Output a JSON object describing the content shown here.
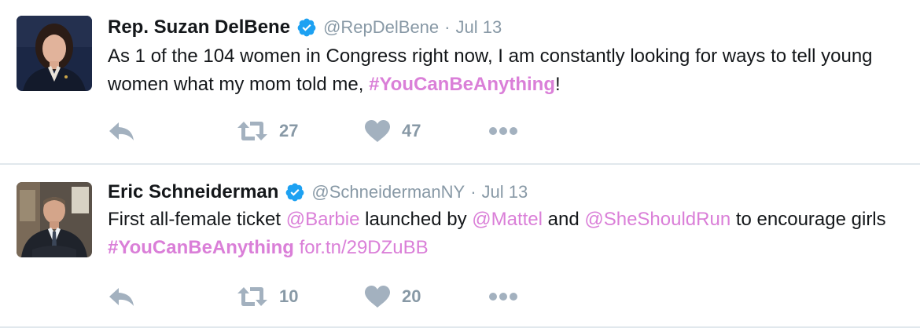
{
  "colors": {
    "name": "#14171a",
    "muted": "#8899a6",
    "highlight": "#da7fd8",
    "verified": "#1da1f2",
    "separator": "#e1e8ed"
  },
  "icons": {
    "reply": "reply-icon",
    "retweet": "retweet-icon",
    "like": "heart-icon",
    "more": "more-icon",
    "verified": "verified-badge-icon"
  },
  "tweets": [
    {
      "name": "Rep. Suzan DelBene",
      "handle": "@RepDelBene",
      "dot": "·",
      "date": "Jul 13",
      "text": {
        "part1": "As 1 of the 104 women in Congress right now, I am constantly looking for ways to tell young women what my mom told me, ",
        "hashtag": "#YouCanBeAnything",
        "part2": "!"
      },
      "retweets": "27",
      "likes": "47"
    },
    {
      "name": "Eric Schneiderman",
      "handle": "@SchneidermanNY",
      "dot": "·",
      "date": "Jul 13",
      "text": {
        "part1": "First all-female ticket ",
        "mention1": "@Barbie",
        "part2": " launched by ",
        "mention2": "@Mattel",
        "part3": " and ",
        "mention3": "@SheShouldRun",
        "part4": " to encourage girls ",
        "hashtag": "#YouCanBeAnything",
        "part5": " ",
        "link": "for.tn/29DZuBB"
      },
      "retweets": "10",
      "likes": "20"
    }
  ]
}
